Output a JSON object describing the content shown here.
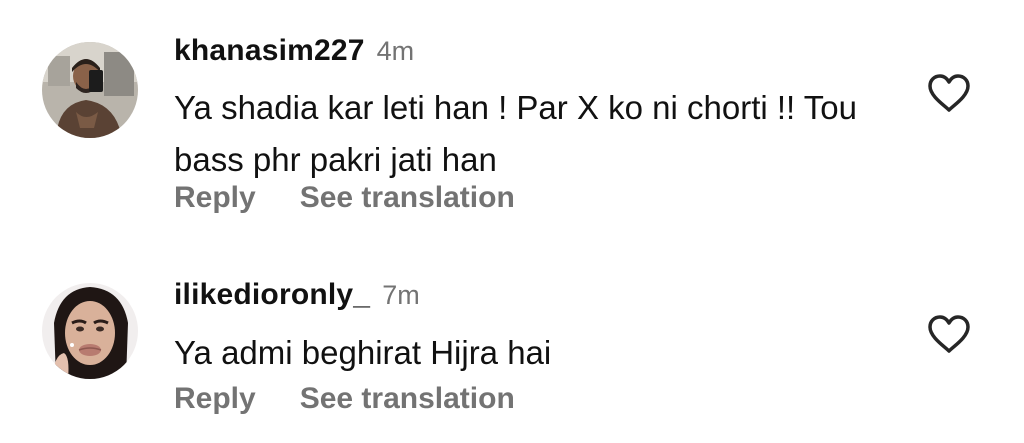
{
  "comments": [
    {
      "username": "khanasim227",
      "time": "4m",
      "text": "Ya shadia kar leti han ! Par X ko ni chorti !! Tou bass phr pakri jati han",
      "reply_label": "Reply",
      "translate_label": "See translation"
    },
    {
      "username": "ilikedioronly_",
      "time": "7m",
      "text": "Ya admi beghirat Hijra hai",
      "reply_label": "Reply",
      "translate_label": "See translation"
    }
  ],
  "icons": {
    "like": "heart-outline-icon"
  },
  "colors": {
    "text_primary": "#111111",
    "text_secondary": "#737373",
    "background": "#ffffff"
  }
}
